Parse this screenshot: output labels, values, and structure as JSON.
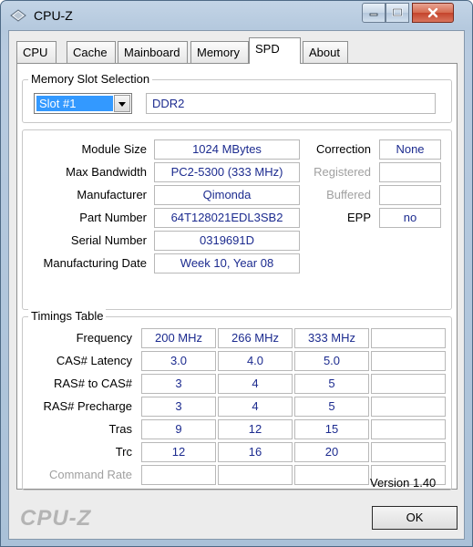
{
  "window": {
    "title": "CPU-Z",
    "icon": "cpuz-diamond-icon"
  },
  "tabs": [
    {
      "label": "CPU"
    },
    {
      "label": "Cache"
    },
    {
      "label": "Mainboard"
    },
    {
      "label": "Memory"
    },
    {
      "label": "SPD",
      "active": true
    },
    {
      "label": "About"
    }
  ],
  "slot_selection": {
    "legend": "Memory Slot Selection",
    "selected_slot": "Slot #1",
    "memory_type": "DDR2"
  },
  "module": {
    "size_label": "Module Size",
    "size": "1024 MBytes",
    "bandwidth_label": "Max Bandwidth",
    "bandwidth": "PC2-5300 (333 MHz)",
    "manufacturer_label": "Manufacturer",
    "manufacturer": "Qimonda",
    "part_label": "Part Number",
    "part": "64T128021EDL3SB2",
    "serial_label": "Serial Number",
    "serial": "0319691D",
    "date_label": "Manufacturing Date",
    "date": "Week 10, Year 08",
    "correction_label": "Correction",
    "correction": "None",
    "registered_label": "Registered",
    "registered": "",
    "buffered_label": "Buffered",
    "buffered": "",
    "epp_label": "EPP",
    "epp": "no"
  },
  "timings": {
    "legend": "Timings Table",
    "rows": [
      {
        "label": "Frequency",
        "values": [
          "200 MHz",
          "266 MHz",
          "333 MHz",
          ""
        ]
      },
      {
        "label": "CAS# Latency",
        "values": [
          "3.0",
          "4.0",
          "5.0",
          ""
        ]
      },
      {
        "label": "RAS# to CAS#",
        "values": [
          "3",
          "4",
          "5",
          ""
        ]
      },
      {
        "label": "RAS# Precharge",
        "values": [
          "3",
          "4",
          "5",
          ""
        ]
      },
      {
        "label": "Tras",
        "values": [
          "9",
          "12",
          "15",
          ""
        ]
      },
      {
        "label": "Trc",
        "values": [
          "12",
          "16",
          "20",
          ""
        ]
      },
      {
        "label": "Command Rate",
        "values": [
          "",
          "",
          "",
          ""
        ],
        "disabled": true
      }
    ]
  },
  "footer": {
    "version": "Version 1.40",
    "logo": "CPU-Z",
    "ok_label": "OK"
  },
  "colors": {
    "value_text": "#1c2b8f",
    "selection": "#3399ff"
  }
}
